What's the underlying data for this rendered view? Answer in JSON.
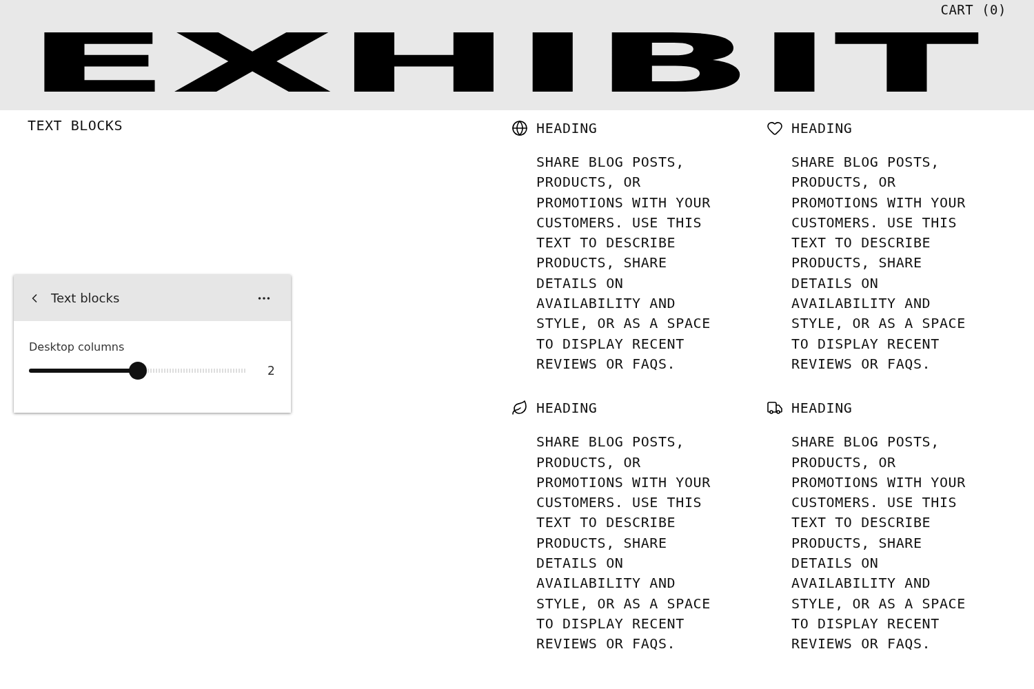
{
  "header": {
    "cart": "CART (0)",
    "logo": "EXHIBIT"
  },
  "section": {
    "title": "TEXT BLOCKS"
  },
  "panel": {
    "title": "Text blocks",
    "setting": {
      "label": "Desktop columns",
      "level": 0.5,
      "reading": "2"
    }
  },
  "blocks": [
    {
      "heading": "HEADING",
      "text": "SHARE BLOG POSTS, PRODUCTS, OR PROMOTIONS WITH YOUR CUSTOMERS. USE THIS TEXT TO DESCRIBE PRODUCTS, SHARE DETAILS ON AVAILABILITY AND STYLE, OR AS A SPACE TO DISPLAY RECENT REVIEWS OR FAQS."
    },
    {
      "heading": "HEADING",
      "text": "SHARE BLOG POSTS, PRODUCTS, OR PROMOTIONS WITH YOUR CUSTOMERS. USE THIS TEXT TO DESCRIBE PRODUCTS, SHARE DETAILS ON AVAILABILITY AND STYLE, OR AS A SPACE TO DISPLAY RECENT REVIEWS OR FAQS."
    },
    {
      "heading": "HEADING",
      "text": "SHARE BLOG POSTS, PRODUCTS, OR PROMOTIONS WITH YOUR CUSTOMERS. USE THIS TEXT TO DESCRIBE PRODUCTS, SHARE DETAILS ON AVAILABILITY AND STYLE, OR AS A SPACE TO DISPLAY RECENT REVIEWS OR FAQS."
    },
    {
      "heading": "HEADING",
      "text": "SHARE BLOG POSTS, PRODUCTS, OR PROMOTIONS WITH YOUR CUSTOMERS. USE THIS TEXT TO DESCRIBE PRODUCTS, SHARE DETAILS ON AVAILABILITY AND STYLE, OR AS A SPACE TO DISPLAY RECENT REVIEWS OR FAQS."
    }
  ]
}
